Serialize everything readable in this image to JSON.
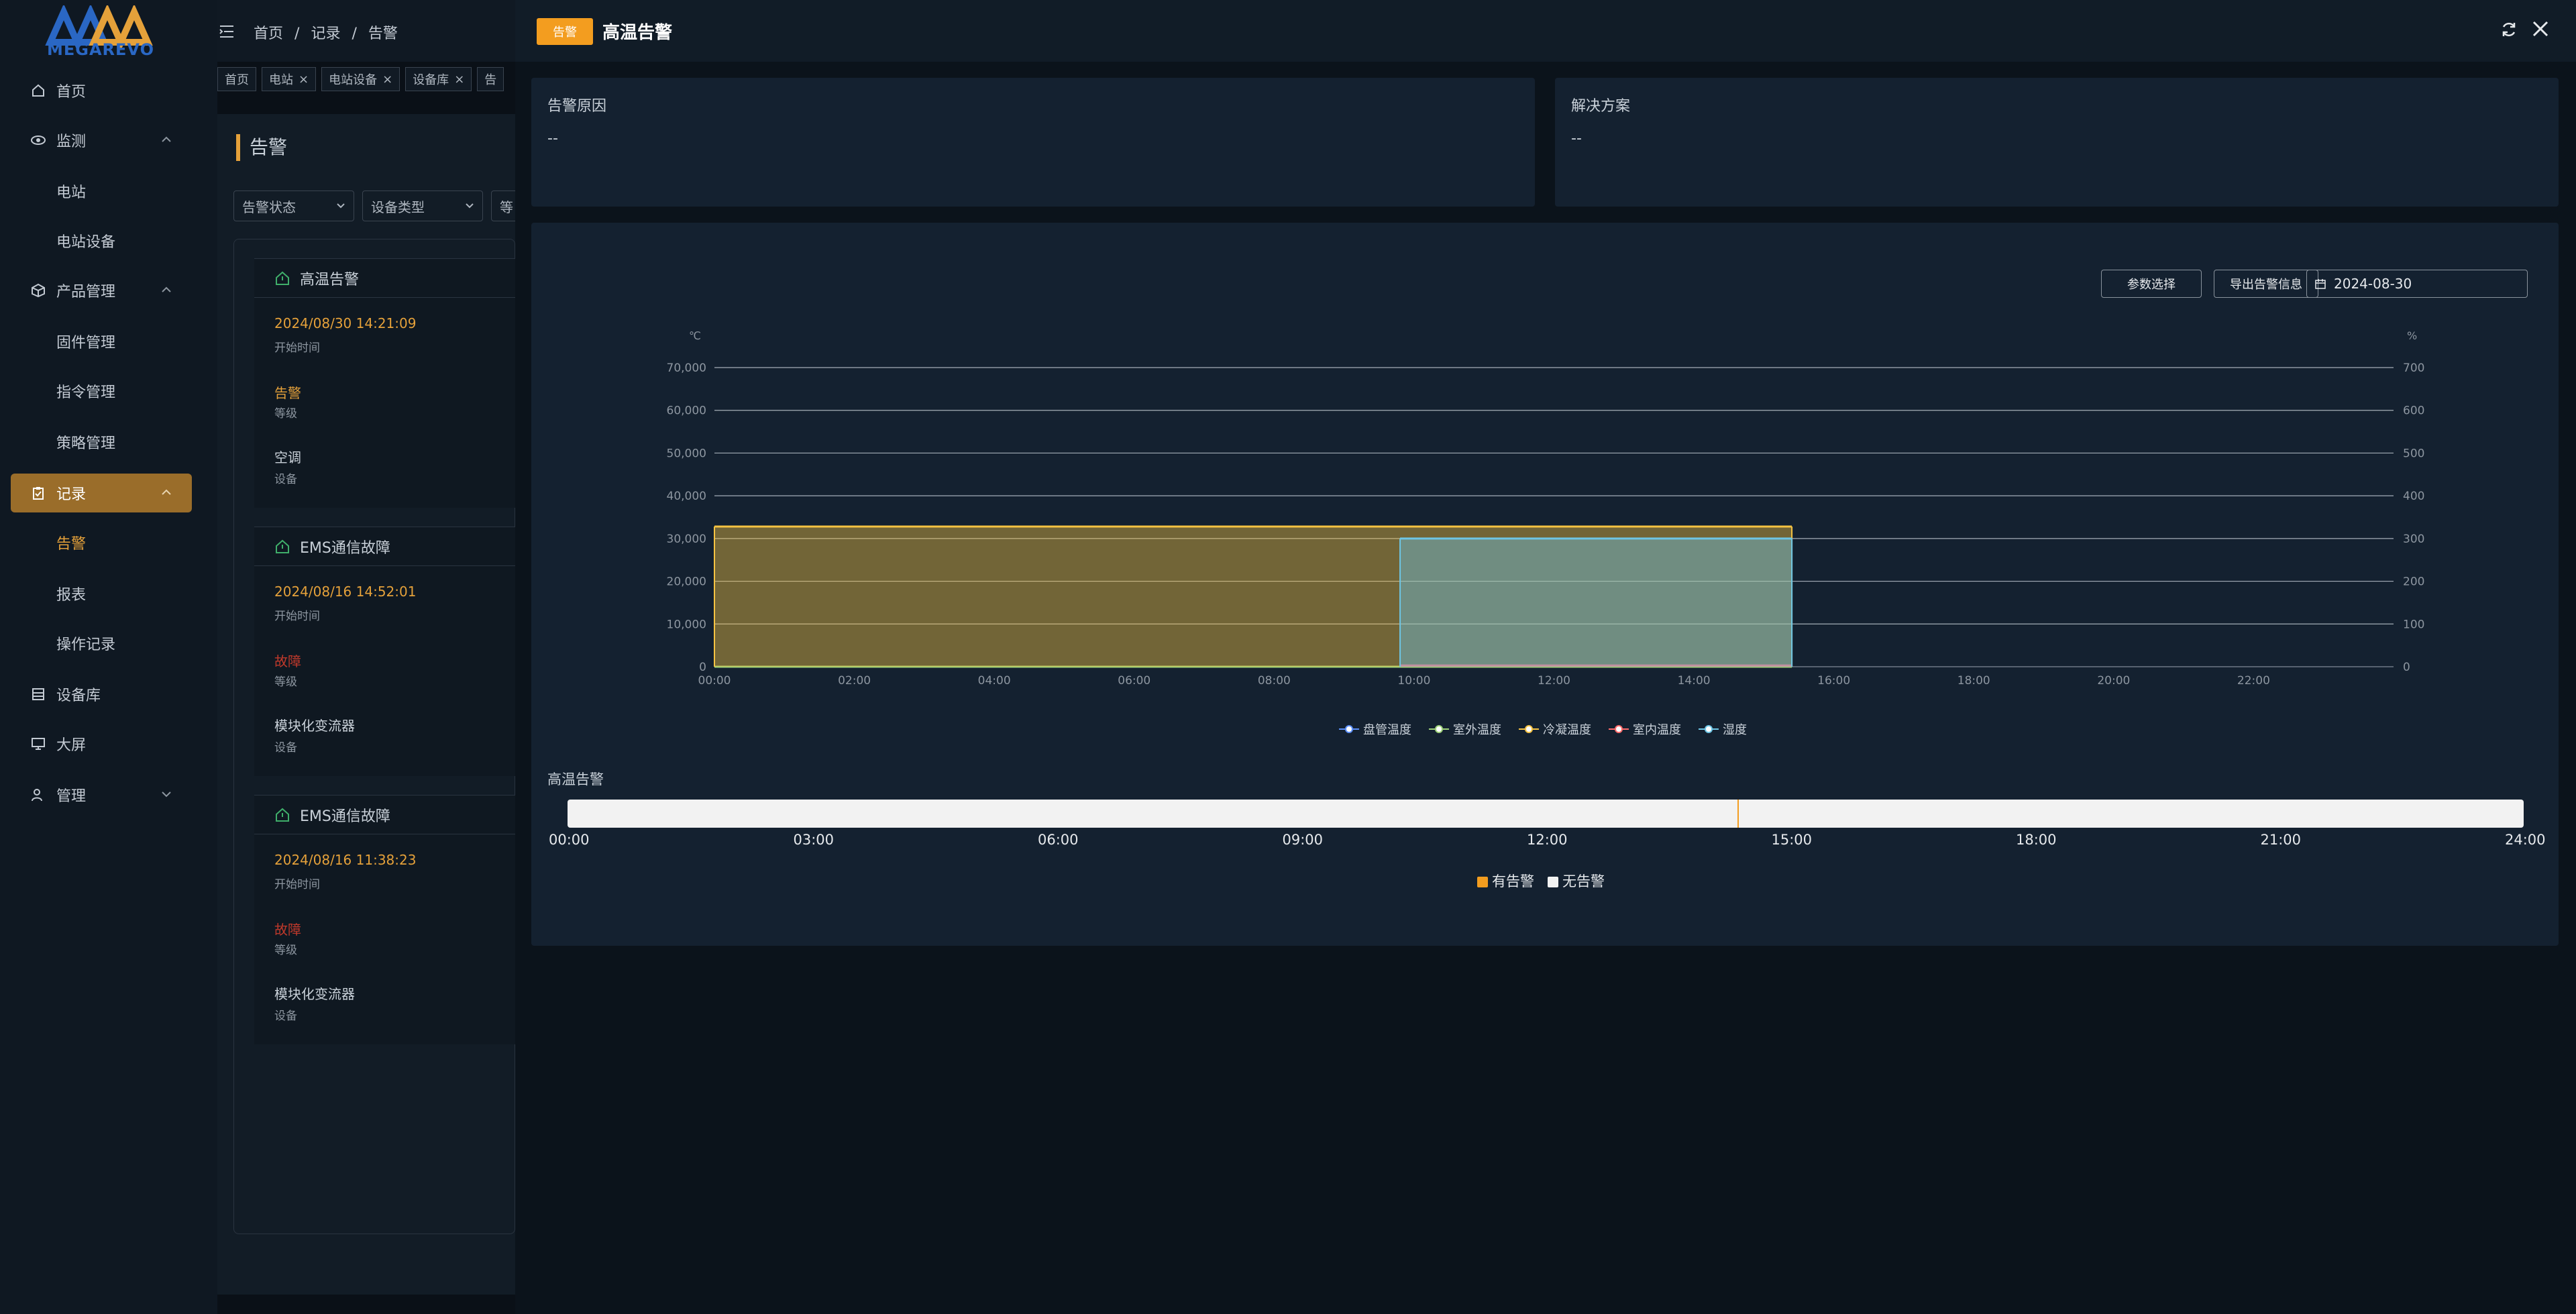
{
  "brand": {
    "logo_text": "MEGAREVO"
  },
  "sidebar": {
    "items": [
      {
        "label": "首页"
      },
      {
        "label": "监测"
      },
      {
        "label": "电站"
      },
      {
        "label": "电站设备"
      },
      {
        "label": "产品管理"
      },
      {
        "label": "固件管理"
      },
      {
        "label": "指令管理"
      },
      {
        "label": "策略管理"
      },
      {
        "label": "记录"
      },
      {
        "label": "告警"
      },
      {
        "label": "报表"
      },
      {
        "label": "操作记录"
      },
      {
        "label": "设备库"
      },
      {
        "label": "大屏"
      },
      {
        "label": "管理"
      }
    ]
  },
  "breadcrumb": {
    "home": "首页",
    "sep1": "/",
    "records": "记录",
    "sep2": "/",
    "alarm": "告警"
  },
  "tags": [
    {
      "label": "首页"
    },
    {
      "label": "电站",
      "close": "×"
    },
    {
      "label": "电站设备",
      "close": "×"
    },
    {
      "label": "设备库",
      "close": "×"
    },
    {
      "label": "告"
    }
  ],
  "page": {
    "title": "告警"
  },
  "filters": {
    "status": "告警状态",
    "device_type": "设备类型",
    "level": "等"
  },
  "alarm_cards": [
    {
      "title": "高温告警",
      "time": "2024/08/30 14:21:09",
      "time_label": "开始时间",
      "level": "告警",
      "level_label": "等级",
      "device": "空调",
      "device_label": "设备",
      "level_color": "#e5a13a"
    },
    {
      "title": "EMS通信故障",
      "time": "2024/08/16 14:52:01",
      "time_label": "开始时间",
      "level": "故障",
      "level_label": "等级",
      "device": "模块化变流器",
      "device_label": "设备",
      "level_color": "#c0392b"
    },
    {
      "title": "EMS通信故障",
      "time": "2024/08/16 11:38:23",
      "time_label": "开始时间",
      "level": "故障",
      "level_label": "等级",
      "device": "模块化变流器",
      "device_label": "设备",
      "level_color": "#c0392b"
    }
  ],
  "drawer": {
    "badge": "告警",
    "title": "高温告警",
    "cause_title": "告警原因",
    "cause_value": "--",
    "solution_title": "解决方案",
    "solution_value": "--",
    "param_button": "参数选择",
    "export_button": "导出告警信息",
    "date": "2024-08-30"
  },
  "chart_data": {
    "type": "area",
    "y_left_unit": "℃",
    "y_right_unit": "%",
    "y_left_ticks": [
      "0",
      "10,000",
      "20,000",
      "30,000",
      "40,000",
      "50,000",
      "60,000",
      "70,000"
    ],
    "y_right_ticks": [
      "0",
      "100",
      "200",
      "300",
      "400",
      "500",
      "600",
      "700"
    ],
    "x_ticks": [
      "00:00",
      "02:00",
      "04:00",
      "06:00",
      "08:00",
      "10:00",
      "12:00",
      "14:00",
      "16:00",
      "18:00",
      "20:00",
      "22:00"
    ],
    "ylim": [
      0,
      70000
    ],
    "series": [
      {
        "name": "盘管温度",
        "color": "#5b8ff9",
        "points": [
          [
            0,
            0
          ],
          [
            15.4,
            0
          ]
        ]
      },
      {
        "name": "室外温度",
        "color": "#9fd27a",
        "points": [
          [
            0,
            0
          ],
          [
            15.4,
            0
          ]
        ]
      },
      {
        "name": "冷凝温度",
        "color": "#f6c342",
        "points": [
          [
            0,
            32800
          ],
          [
            15.4,
            32800
          ]
        ]
      },
      {
        "name": "室内温度",
        "color": "#ff6b6b",
        "points": [
          [
            9.8,
            300
          ],
          [
            15.4,
            300
          ]
        ]
      },
      {
        "name": "湿度",
        "color": "#6ec6e6",
        "points": [
          [
            9.8,
            30000
          ],
          [
            15.4,
            30000
          ]
        ]
      }
    ]
  },
  "timeline": {
    "title": "高温告警",
    "ticks": [
      "00:00",
      "03:00",
      "06:00",
      "09:00",
      "12:00",
      "15:00",
      "18:00",
      "21:00",
      "24:00"
    ],
    "legend_alarm": "有告警",
    "legend_none": "无告警",
    "alarm_color": "#f39d1f",
    "none_color": "#f2f2f2"
  }
}
